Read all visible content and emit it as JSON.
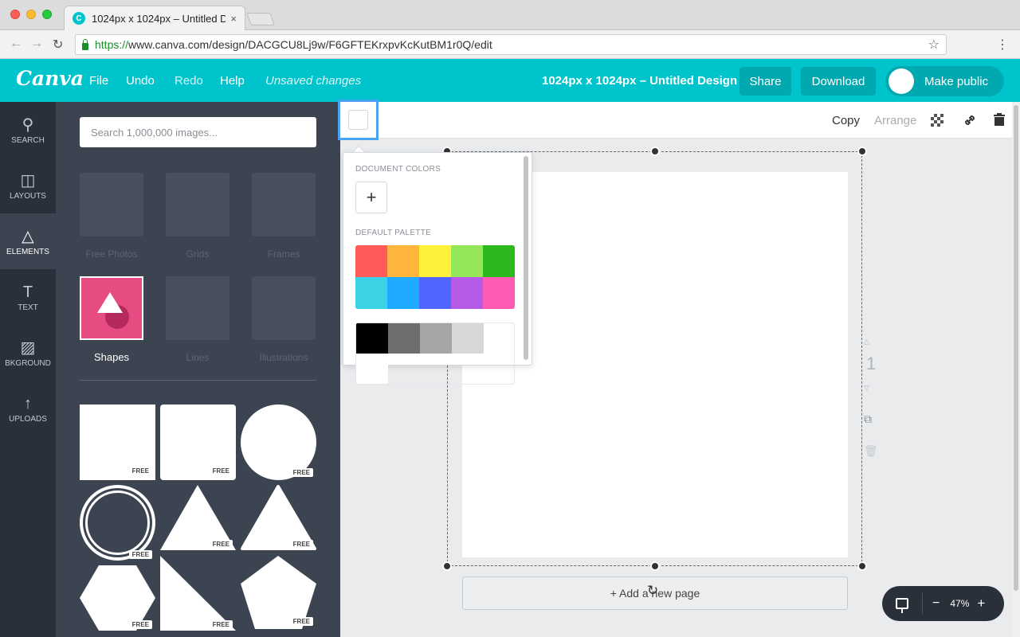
{
  "browser": {
    "tab_title": "1024px x 1024px – Untitled D",
    "tab_close": "×",
    "favicon_letter": "C",
    "url_scheme": "https://",
    "url_rest": "www.canva.com/design/DACGCU8Lj9w/F6GFTEKrxpvKcKutBM1r0Q/edit",
    "nav_back": "←",
    "nav_forward": "→",
    "reload": "↻",
    "star": "☆",
    "menu": "⋮"
  },
  "header": {
    "logo": "Canva",
    "menu": {
      "file": "File",
      "undo": "Undo",
      "redo": "Redo",
      "help": "Help",
      "unsaved": "Unsaved changes"
    },
    "doc_title": "1024px x 1024px – Untitled Design",
    "share": "Share",
    "download": "Download",
    "make_public": "Make public"
  },
  "rail": {
    "items": [
      {
        "label": "SEARCH",
        "icon": "⚲"
      },
      {
        "label": "LAYOUTS",
        "icon": "◫"
      },
      {
        "label": "ELEMENTS",
        "icon": "△"
      },
      {
        "label": "TEXT",
        "icon": "T"
      },
      {
        "label": "BKGROUND",
        "icon": "▨"
      },
      {
        "label": "UPLOADS",
        "icon": "↑"
      }
    ]
  },
  "panel": {
    "search_placeholder": "Search 1,000,000 images...",
    "categories": {
      "free_photos": "Free Photos",
      "grids": "Grids",
      "frames": "Frames",
      "shapes": "Shapes",
      "lines": "Lines",
      "illustrations": "Illustrations"
    },
    "free_tag": "FREE"
  },
  "context_bar": {
    "copy": "Copy",
    "arrange": "Arrange",
    "link_icon": "🔗",
    "trash_icon": "🗑"
  },
  "popover": {
    "document_colors": "DOCUMENT COLORS",
    "add": "+",
    "default_palette": "DEFAULT PALETTE",
    "palette_rows": [
      [
        "#ff5a5a",
        "#ffb43c",
        "#fff03c",
        "#96e65a",
        "#2db91e"
      ],
      [
        "#3cd2e6",
        "#1eaaff",
        "#5064ff",
        "#b45ae6",
        "#ff5ab4"
      ],
      [
        "#000000",
        "#6e6e6e",
        "#a5a5a5",
        "#d7d7d7",
        "#ffffff"
      ]
    ]
  },
  "canvas": {
    "page_number": "1",
    "add_page": "+ Add a new page",
    "rotate_icon": "↻"
  },
  "zoom": {
    "minus": "−",
    "value": "47%",
    "plus": "+"
  }
}
